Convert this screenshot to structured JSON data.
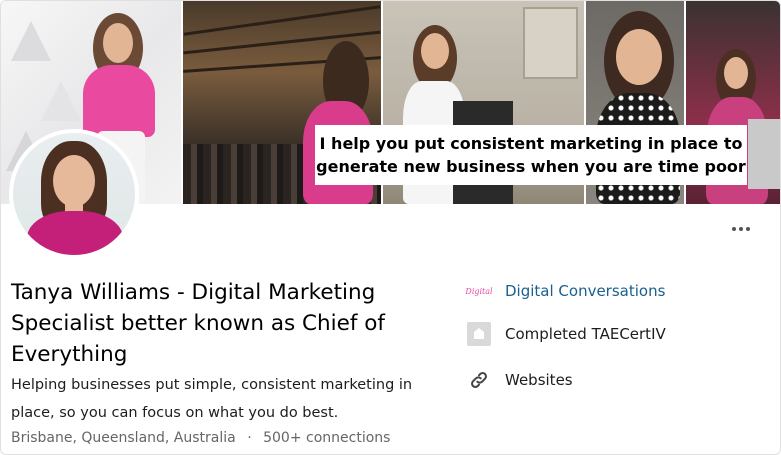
{
  "banner": {
    "caption_line1": "I help you put consistent marketing in place to",
    "caption_line2": "generate new business when you are time poor"
  },
  "profile": {
    "name": "Tanya Williams - Digital Marketing Specialist better known as Chief of Everything",
    "headline": "Helping businesses put simple, consistent marketing in place, so you can focus on what you do best.",
    "location": "Brisbane, Queensland, Australia",
    "separator": "·",
    "connections": "500+ connections"
  },
  "side": {
    "company": {
      "label": "Digital Conversations",
      "logo_text": "Digital",
      "icon": "digital-conversations-logo"
    },
    "education": {
      "label": "Completed TAECertIV",
      "icon": "school-icon"
    },
    "websites": {
      "label": "Websites",
      "icon": "link-icon"
    }
  },
  "colors": {
    "link": "#1a5f8e",
    "accent_pink": "#e94aa0",
    "muted_text": "#666666"
  }
}
